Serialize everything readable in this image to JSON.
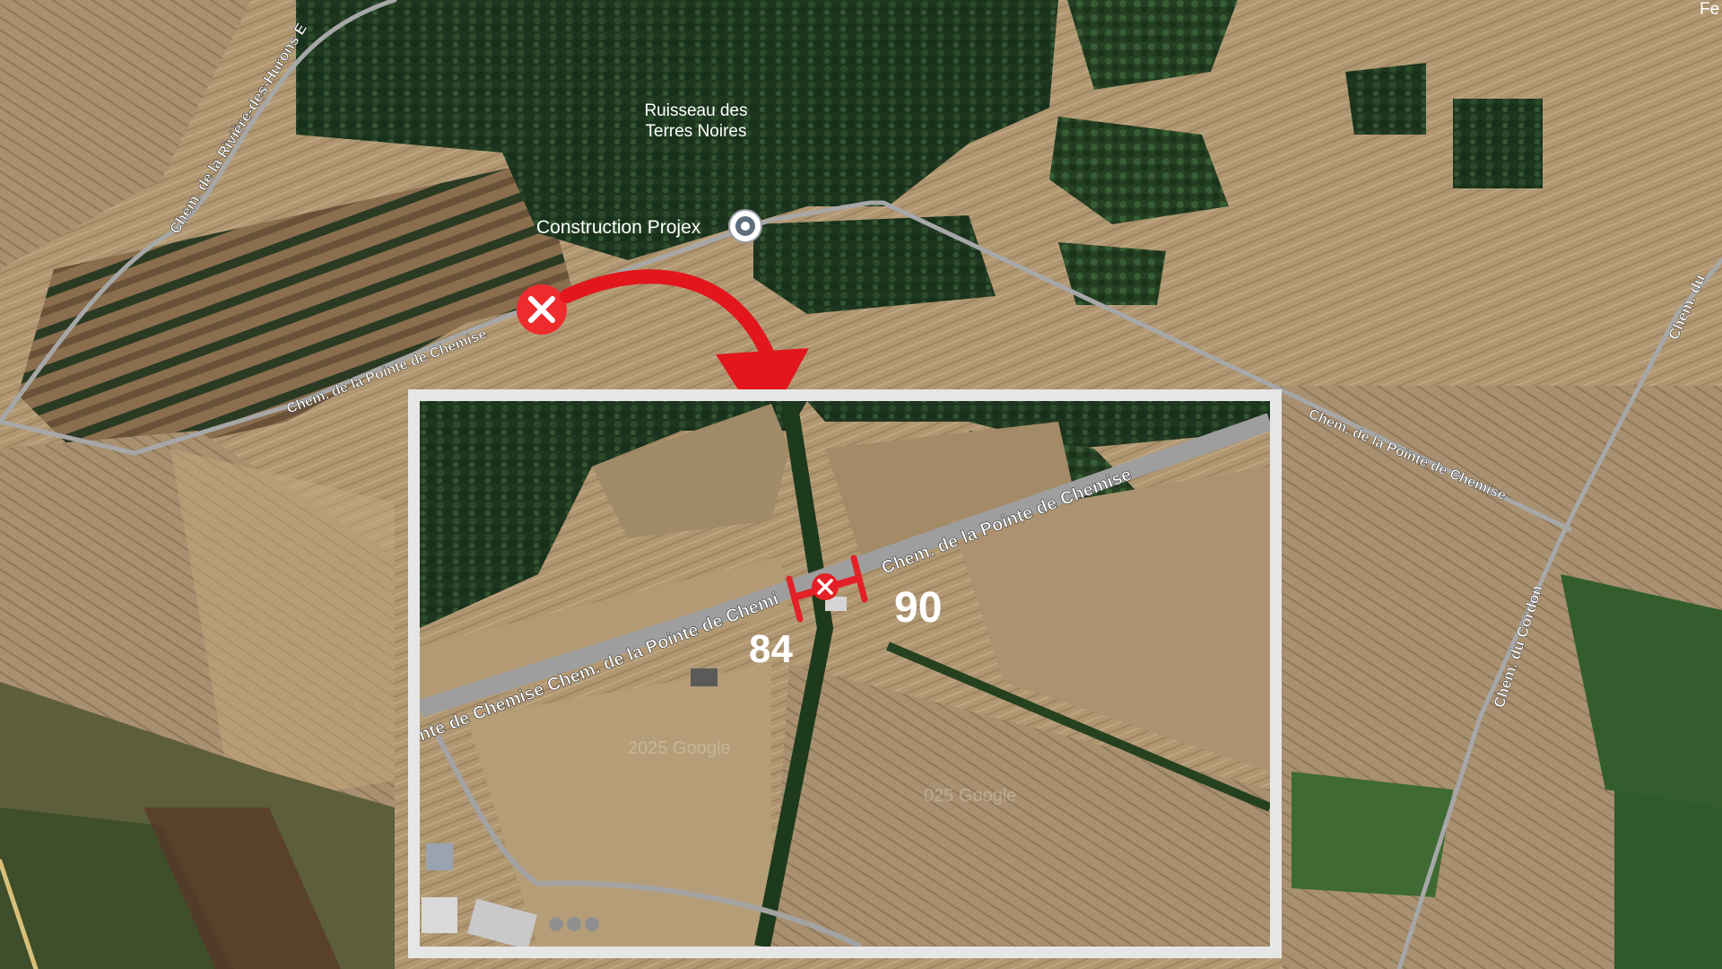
{
  "map": {
    "labels": {
      "road_huron": "Chem. de la Rivière-des-Hurons E",
      "poi_ruisseau_line1": "Ruisseau des",
      "poi_ruisseau_line2": "Terres Noires",
      "poi_projex": "Construction Projex",
      "road_pointe_left": "Chem. de la Pointe de Chemise",
      "road_pointe_right": "Chem. de la Pointe de Chemise",
      "road_cordon_upper": "Chem. du",
      "road_cordon_lower": "Chem. du Cordon",
      "corner_text": "Fe"
    },
    "icons": {
      "place_pin": "map-pin-icon",
      "marker_main": "close-marker-icon",
      "marker_inset": "close-marker-icon",
      "arrow": "curved-arrow-icon"
    },
    "colors": {
      "marker_red": "#ef2b2d",
      "arrow_red": "#e3161c",
      "road_grey": "#a7a7a7",
      "field_tan": "#b39a73",
      "forest_green": "#1f3a1f",
      "inset_frame": "#e6e6e6"
    }
  },
  "inset": {
    "labels": {
      "road_main": "Chem. de la Pointe de Chemise",
      "road_left": "nte de Chemise Chem. de la Pointe de Chemi"
    },
    "address_left": "84",
    "address_right": "90",
    "watermark_1": "2025 Google",
    "watermark_2": "025 Google"
  }
}
